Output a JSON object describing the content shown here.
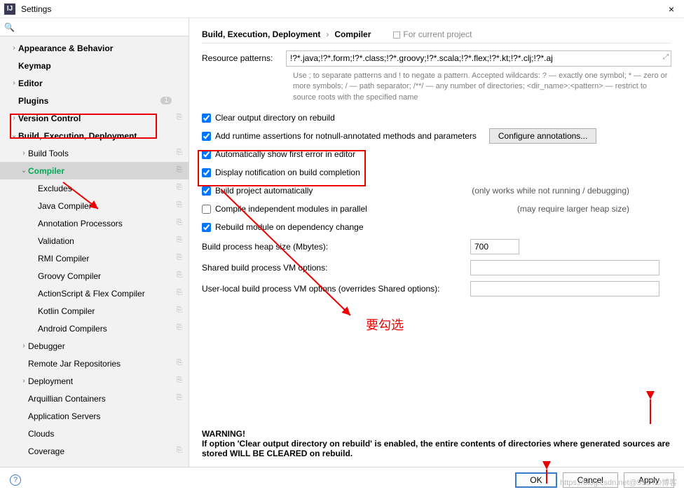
{
  "window": {
    "title": "Settings",
    "close": "×",
    "app_glyph": "IJ"
  },
  "search": {
    "placeholder": "",
    "icon": "🔍"
  },
  "sidebar": {
    "items": [
      {
        "label": "Appearance & Behavior",
        "bold": true,
        "chev": "›",
        "pad": 1
      },
      {
        "label": "Keymap",
        "bold": true,
        "pad": 1
      },
      {
        "label": "Editor",
        "bold": true,
        "chev": "›",
        "pad": 1
      },
      {
        "label": "Plugins",
        "bold": true,
        "pad": 1,
        "badge": "1"
      },
      {
        "label": "Version Control",
        "bold": true,
        "chev": "›",
        "pad": 1,
        "proj": true
      },
      {
        "label": "Build, Execution, Deployment",
        "bold": true,
        "chev": "⌄",
        "pad": 1
      },
      {
        "label": "Build Tools",
        "chev": "›",
        "pad": 2,
        "proj": true
      },
      {
        "label": "Compiler",
        "chev": "⌄",
        "pad": 2,
        "proj": true,
        "selected": true
      },
      {
        "label": "Excludes",
        "pad": 3,
        "proj": true
      },
      {
        "label": "Java Compiler",
        "pad": 3,
        "proj": true
      },
      {
        "label": "Annotation Processors",
        "pad": 3,
        "proj": true
      },
      {
        "label": "Validation",
        "pad": 3,
        "proj": true
      },
      {
        "label": "RMI Compiler",
        "pad": 3,
        "proj": true
      },
      {
        "label": "Groovy Compiler",
        "pad": 3,
        "proj": true
      },
      {
        "label": "ActionScript & Flex Compiler",
        "pad": 3,
        "proj": true
      },
      {
        "label": "Kotlin Compiler",
        "pad": 3,
        "proj": true
      },
      {
        "label": "Android Compilers",
        "pad": 3,
        "proj": true
      },
      {
        "label": "Debugger",
        "chev": "›",
        "pad": 2
      },
      {
        "label": "Remote Jar Repositories",
        "pad": 2,
        "proj": true
      },
      {
        "label": "Deployment",
        "chev": "›",
        "pad": 2,
        "proj": true
      },
      {
        "label": "Arquillian Containers",
        "pad": 2,
        "proj": true
      },
      {
        "label": "Application Servers",
        "pad": 2
      },
      {
        "label": "Clouds",
        "pad": 2
      },
      {
        "label": "Coverage",
        "pad": 2,
        "proj": true
      }
    ]
  },
  "breadcrumb": {
    "part1": "Build, Execution, Deployment",
    "sep": "›",
    "part2": "Compiler",
    "scope": "For current project"
  },
  "patterns": {
    "label": "Resource patterns:",
    "value": "!?*.java;!?*.form;!?*.class;!?*.groovy;!?*.scala;!?*.flex;!?*.kt;!?*.clj;!?*.aj",
    "hint": "Use ; to separate patterns and ! to negate a pattern. Accepted wildcards: ? — exactly one symbol; * — zero or more symbols; / — path separator; /**/ — any number of directories; <dir_name>:<pattern> — restrict to source roots with the specified name"
  },
  "checks": {
    "clear": "Clear output directory on rebuild",
    "assertions": "Add runtime assertions for notnull-annotated methods and parameters",
    "configure": "Configure annotations...",
    "firstError": "Automatically show first error in editor",
    "notify": "Display notification on build completion",
    "auto": "Build project automatically",
    "auto_side": "(only works while not running / debugging)",
    "parallel": "Compile independent modules in parallel",
    "parallel_side": "(may require larger heap size)",
    "rebuild": "Rebuild module on dependency change"
  },
  "heap": {
    "label": "Build process heap size (Mbytes):",
    "value": "700"
  },
  "sharedVm": {
    "label": "Shared build process VM options:",
    "value": ""
  },
  "userVm": {
    "label": "User-local build process VM options (overrides Shared options):",
    "value": ""
  },
  "warning": {
    "title": "WARNING!",
    "body": "If option 'Clear output directory on rebuild' is enabled, the entire contents of directories where generated sources are stored WILL BE CLEARED on rebuild."
  },
  "annotation": {
    "label": "要勾选"
  },
  "footer": {
    "ok": "OK",
    "cancel": "Cancel",
    "apply": "Apply",
    "help": "?"
  },
  "watermark": "https://blog.csdn.net@51CTO博客"
}
